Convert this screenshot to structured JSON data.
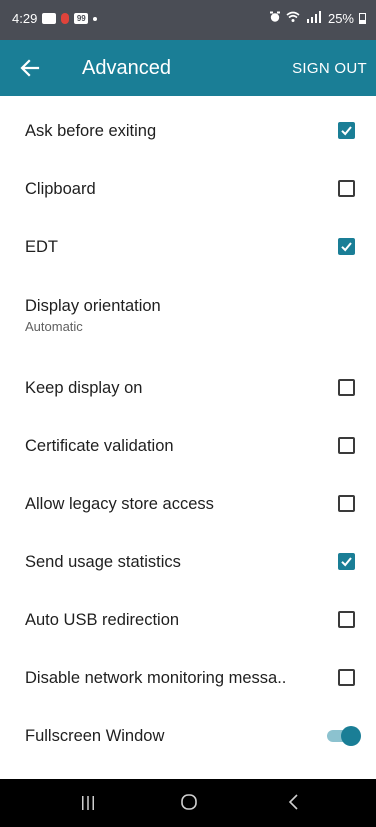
{
  "status_bar": {
    "time": "4:29",
    "badge": "99",
    "battery": "25%"
  },
  "app_bar": {
    "title": "Advanced",
    "sign_out": "SIGN OUT",
    "back_icon": "arrow-back-icon"
  },
  "settings": [
    {
      "label": "Ask before exiting",
      "control": "checkbox",
      "checked": true
    },
    {
      "label": "Clipboard",
      "control": "checkbox",
      "checked": false
    },
    {
      "label": "EDT",
      "control": "checkbox",
      "checked": true
    },
    {
      "label": "Display orientation",
      "sub": "Automatic",
      "control": "none"
    },
    {
      "label": "Keep display on",
      "control": "checkbox",
      "checked": false
    },
    {
      "label": "Certificate validation",
      "control": "checkbox",
      "checked": false
    },
    {
      "label": "Allow legacy store access",
      "control": "checkbox",
      "checked": false
    },
    {
      "label": "Send usage statistics",
      "control": "checkbox",
      "checked": true
    },
    {
      "label": "Auto USB redirection",
      "control": "checkbox",
      "checked": false
    },
    {
      "label": "Disable network monitoring messa..",
      "control": "checkbox",
      "checked": false
    },
    {
      "label": "Fullscreen Window",
      "control": "toggle",
      "on": true
    }
  ],
  "colors": {
    "accent": "#1a7e96",
    "status_bar": "#4a4d55",
    "nav_bar": "#000000"
  },
  "nav_bar": {
    "recents_icon": "recents-icon",
    "home_icon": "home-icon",
    "back_icon": "nav-back-icon"
  }
}
